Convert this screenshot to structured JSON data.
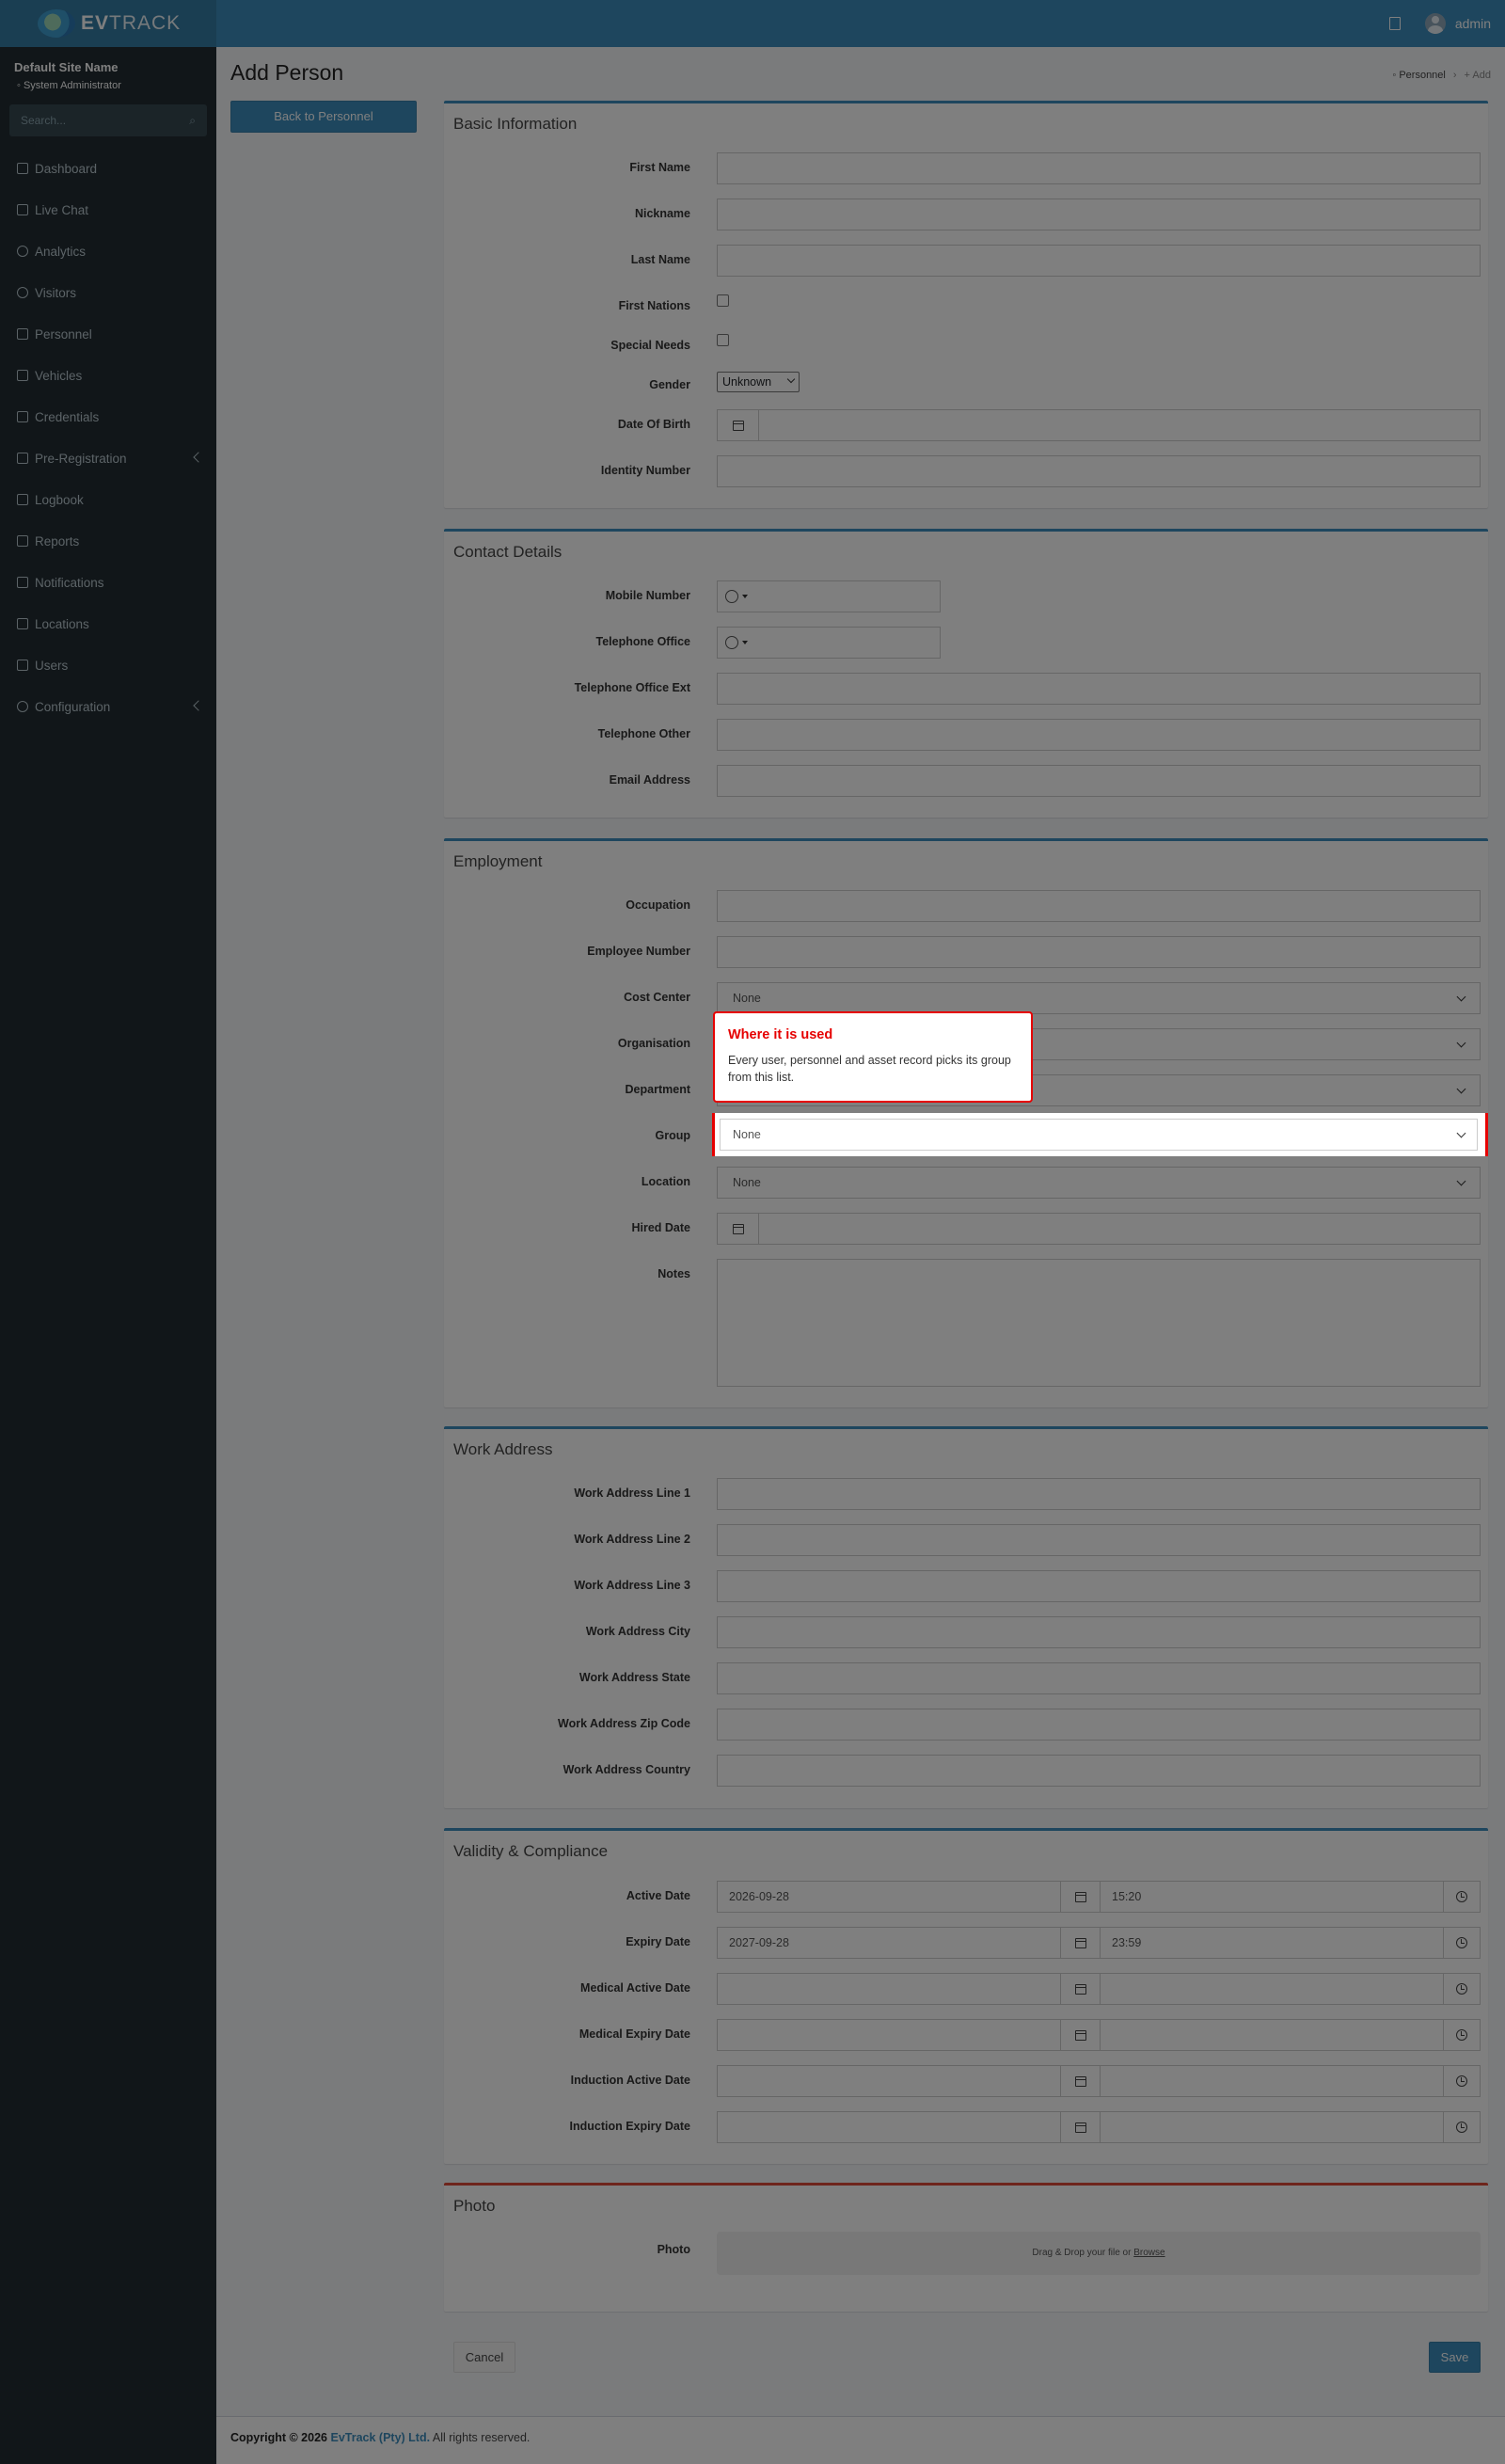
{
  "brand": {
    "name_bold": "EV",
    "name_rest": "TRACK"
  },
  "topbar": {
    "user_name": "admin"
  },
  "sidebar": {
    "site_name": "Default Site Name",
    "role": "System Administrator",
    "search_placeholder": "Search...",
    "items": [
      {
        "label": "Dashboard"
      },
      {
        "label": "Live Chat"
      },
      {
        "label": "Analytics"
      },
      {
        "label": "Visitors"
      },
      {
        "label": "Personnel"
      },
      {
        "label": "Vehicles"
      },
      {
        "label": "Credentials"
      },
      {
        "label": "Pre-Registration"
      },
      {
        "label": "Logbook"
      },
      {
        "label": "Reports"
      },
      {
        "label": "Notifications"
      },
      {
        "label": "Locations"
      },
      {
        "label": "Users"
      },
      {
        "label": "Configuration"
      }
    ]
  },
  "page": {
    "title": "Add Person",
    "back_label": "Back to Personnel"
  },
  "breadcrumb": {
    "parent": "Personnel",
    "current": "Add"
  },
  "basic": {
    "title": "Basic Information",
    "first_name": "First Name",
    "nickname": "Nickname",
    "last_name": "Last Name",
    "first_nations": "First Nations",
    "special_needs": "Special Needs",
    "gender": "Gender",
    "gender_value": "Unknown",
    "dob": "Date Of Birth",
    "identity": "Identity Number"
  },
  "contact": {
    "title": "Contact Details",
    "mobile": "Mobile Number",
    "tel_office": "Telephone Office",
    "tel_office_ext": "Telephone Office Ext",
    "tel_other": "Telephone Other",
    "email": "Email Address"
  },
  "employment": {
    "title": "Employment",
    "occupation": "Occupation",
    "employee_number": "Employee Number",
    "cost_center": "Cost Center",
    "cost_center_value": "None",
    "organisation": "Organisation",
    "department": "Department",
    "group": "Group",
    "group_value": "None",
    "location": "Location",
    "location_value": "None",
    "hired_date": "Hired Date",
    "notes": "Notes"
  },
  "work": {
    "title": "Work Address",
    "line1": "Work Address Line 1",
    "line2": "Work Address Line 2",
    "line3": "Work Address Line 3",
    "city": "Work Address City",
    "state": "Work Address State",
    "zip": "Work Address Zip Code",
    "country": "Work Address Country"
  },
  "validity": {
    "title": "Validity & Compliance",
    "active": "Active Date",
    "active_date": "2026-09-28",
    "active_time": "15:20",
    "expiry": "Expiry Date",
    "expiry_date": "2027-09-28",
    "expiry_time": "23:59",
    "medical_active": "Medical Active Date",
    "medical_expiry": "Medical Expiry Date",
    "induction_active": "Induction Active Date",
    "induction_expiry": "Induction Expiry Date"
  },
  "photo": {
    "title": "Photo",
    "label": "Photo",
    "drop_text": "Drag & Drop your file or ",
    "browse": "Browse"
  },
  "actions": {
    "cancel": "Cancel",
    "save": "Save"
  },
  "footer": {
    "copyright": "Copyright © 2026",
    "company": "EvTrack (Pty) Ltd.",
    "rights": "All rights reserved."
  },
  "tooltip": {
    "title": "Where it is used",
    "body": "Every user, personnel and asset record picks its group from this list."
  },
  "colors": {
    "accent": "#3c8dbc",
    "sidebar": "#222d32",
    "highlight": "#e60000"
  }
}
